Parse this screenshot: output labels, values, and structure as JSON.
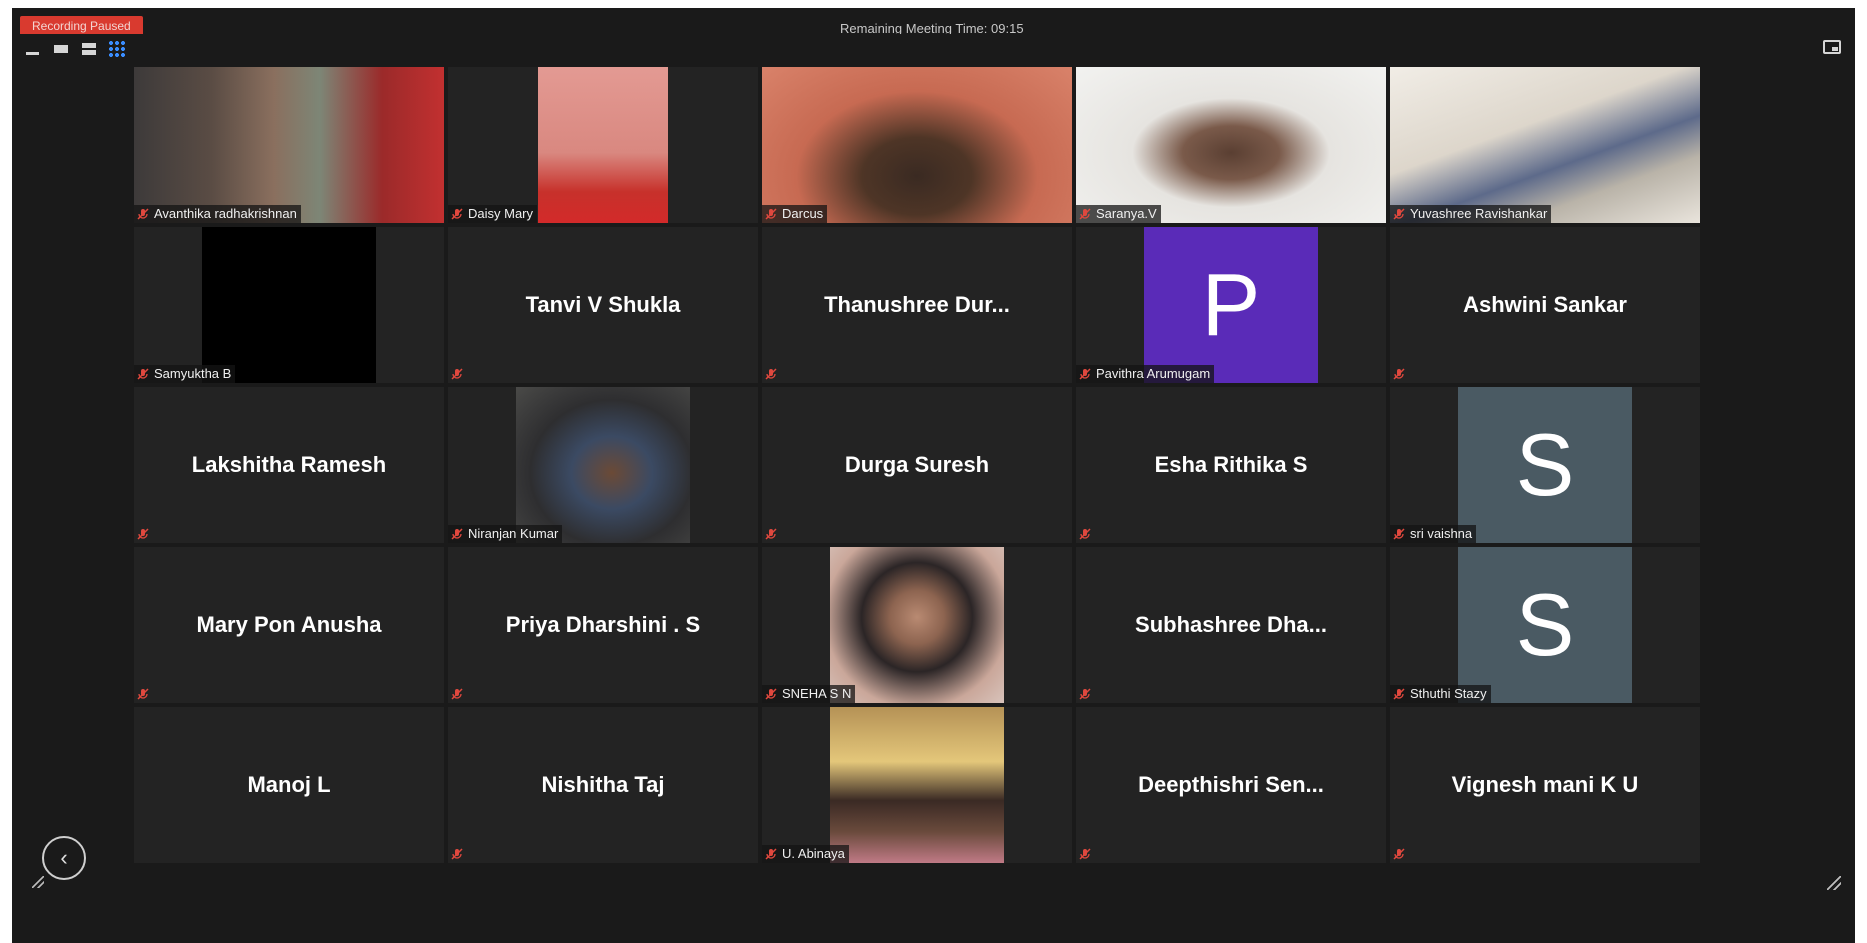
{
  "header": {
    "recording_status": "Recording Paused",
    "meeting_time": "Remaining Meeting Time: 09:15"
  },
  "colors": {
    "background": "#1a1a1a",
    "tile": "#232323",
    "recording_badge": "#d93a2f",
    "avatar_purple": "#5a2bb8",
    "avatar_slate": "#4a5a63",
    "muted_mic": "#e0483e",
    "active_view": "#3a8dff"
  },
  "view_controls": [
    "minimize-icon",
    "speaker-view-icon",
    "strip-view-icon",
    "gallery-view-icon"
  ],
  "participants": [
    {
      "name": "Avanthika radhakrishnan",
      "kind": "video"
    },
    {
      "name": "Daisy Mary",
      "kind": "video"
    },
    {
      "name": "Darcus",
      "kind": "video"
    },
    {
      "name": "Saranya.V",
      "kind": "video"
    },
    {
      "name": "Yuvashree Ravishankar",
      "kind": "video"
    },
    {
      "name": "Samyuktha B",
      "kind": "video"
    },
    {
      "name": "Tanvi V Shukla",
      "kind": "name"
    },
    {
      "name": "Thanushree  Dur...",
      "kind": "name"
    },
    {
      "name": "Pavithra Arumugam",
      "kind": "avatar",
      "letter": "P"
    },
    {
      "name": "Ashwini Sankar",
      "kind": "name"
    },
    {
      "name": "Lakshitha Ramesh",
      "kind": "name"
    },
    {
      "name": "Niranjan Kumar",
      "kind": "video"
    },
    {
      "name": "Durga Suresh",
      "kind": "name"
    },
    {
      "name": "Esha Rithika S",
      "kind": "name"
    },
    {
      "name": "sri vaishna",
      "kind": "avatar",
      "letter": "S"
    },
    {
      "name": "Mary Pon Anusha",
      "kind": "name"
    },
    {
      "name": "Priya Dharshini . S",
      "kind": "name"
    },
    {
      "name": "SNEHA S N",
      "kind": "video"
    },
    {
      "name": "Subhashree  Dha...",
      "kind": "name"
    },
    {
      "name": "Sthuthi Stazy",
      "kind": "avatar",
      "letter": "S"
    },
    {
      "name": "Manoj L",
      "kind": "name"
    },
    {
      "name": "Nishitha Taj",
      "kind": "name"
    },
    {
      "name": "U. Abinaya",
      "kind": "video"
    },
    {
      "name": "Deepthishri  Sen...",
      "kind": "name"
    },
    {
      "name": "Vignesh mani K U",
      "kind": "name"
    }
  ]
}
